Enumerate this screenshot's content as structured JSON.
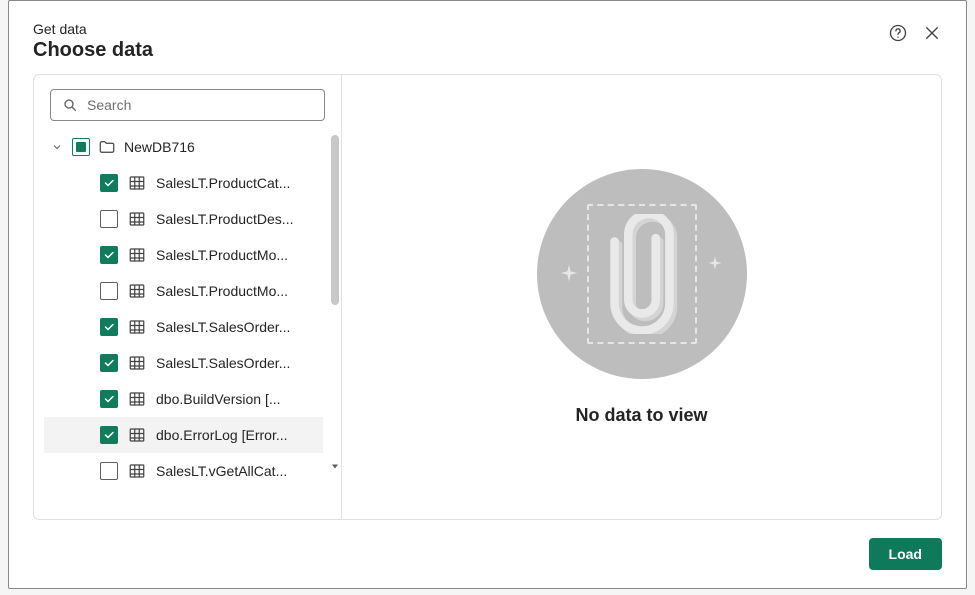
{
  "header": {
    "subtitle": "Get data",
    "title": "Choose data"
  },
  "search": {
    "placeholder": "Search"
  },
  "tree": {
    "root": {
      "label": "NewDB716",
      "state": "indeterminate"
    },
    "items": [
      {
        "label": "SalesLT.ProductCat...",
        "checked": true
      },
      {
        "label": "SalesLT.ProductDes...",
        "checked": false
      },
      {
        "label": "SalesLT.ProductMo...",
        "checked": true
      },
      {
        "label": "SalesLT.ProductMo...",
        "checked": false
      },
      {
        "label": "SalesLT.SalesOrder...",
        "checked": true
      },
      {
        "label": "SalesLT.SalesOrder...",
        "checked": true
      },
      {
        "label": "dbo.BuildVersion [...",
        "checked": true
      },
      {
        "label": "dbo.ErrorLog [Error...",
        "checked": true,
        "hovered": true
      },
      {
        "label": "SalesLT.vGetAllCat...",
        "checked": false
      }
    ]
  },
  "empty": {
    "message": "No data to view"
  },
  "footer": {
    "load_label": "Load"
  }
}
